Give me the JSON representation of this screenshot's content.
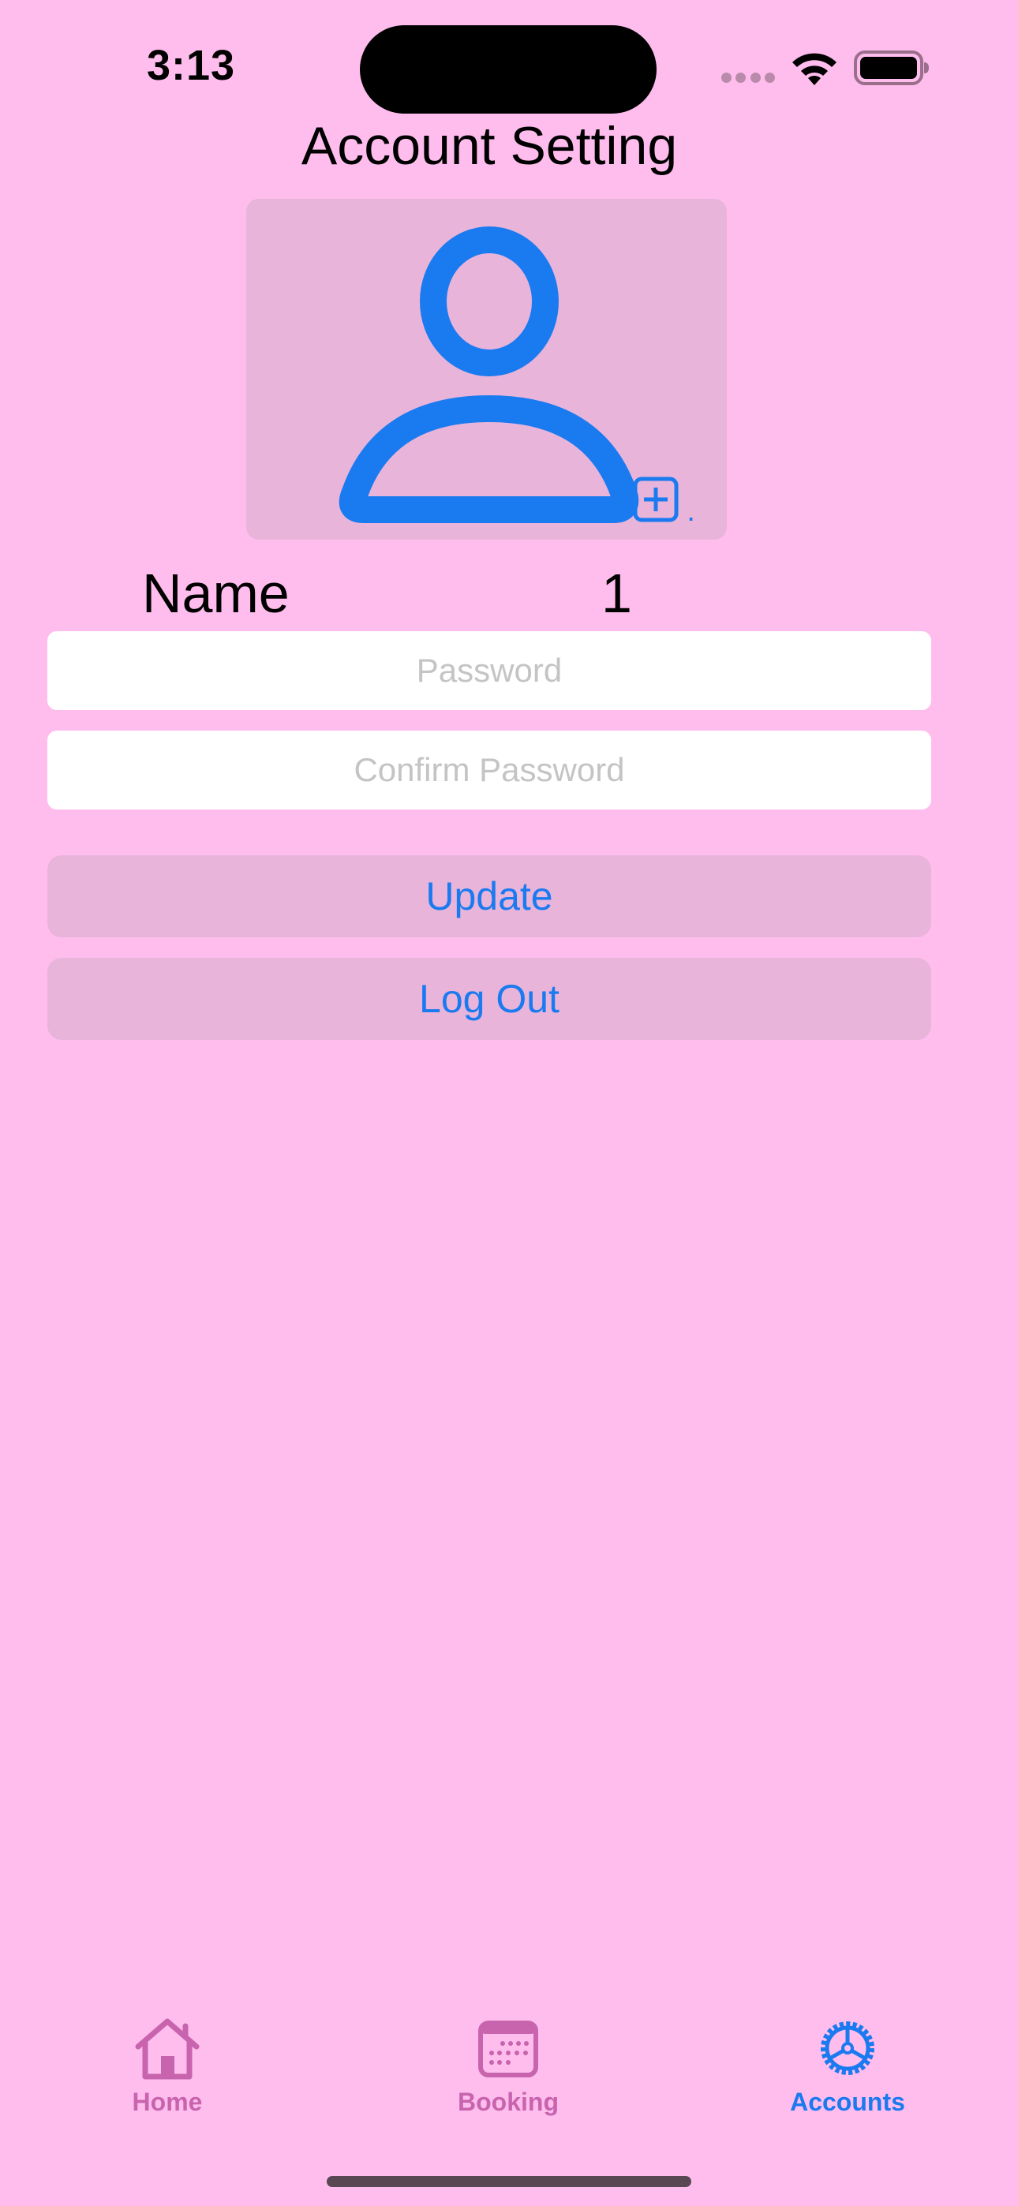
{
  "status_bar": {
    "time": "3:13",
    "signal_icon": "cellular-dots-icon",
    "wifi_icon": "wifi-icon",
    "battery_icon": "battery-icon",
    "battery_level": 1.0
  },
  "page": {
    "title": "Account Setting"
  },
  "avatar": {
    "icon": "person-icon",
    "add_icon": "plus-square-icon",
    "add_suffix": "."
  },
  "profile": {
    "name_label": "Name",
    "name_value": "1"
  },
  "form": {
    "password_placeholder": "Password",
    "password_value": "",
    "confirm_placeholder": "Confirm Password",
    "confirm_value": ""
  },
  "actions": {
    "update_label": "Update",
    "logout_label": "Log Out"
  },
  "tab_bar": {
    "items": [
      {
        "label": "Home",
        "icon": "house-icon",
        "active": false
      },
      {
        "label": "Booking",
        "icon": "calendar-icon",
        "active": false
      },
      {
        "label": "Accounts",
        "icon": "gear-icon",
        "active": true
      }
    ]
  },
  "colors": {
    "background": "#FFBDEE",
    "panel": "#E8B4DA",
    "accent": "#1A7AEF",
    "inactive_tab": "#C764AD"
  }
}
